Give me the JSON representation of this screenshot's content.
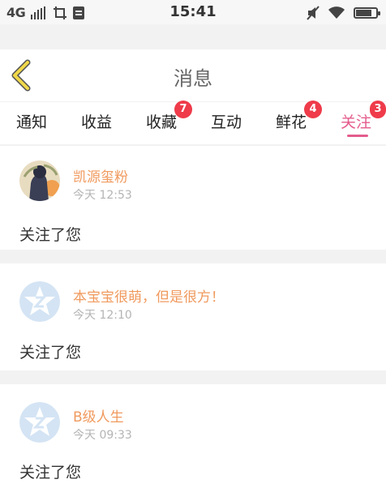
{
  "status_bar": {
    "network": "4G",
    "time": "15:41"
  },
  "header": {
    "title": "消息"
  },
  "tabs": [
    {
      "label": "通知",
      "badge": ""
    },
    {
      "label": "收益",
      "badge": ""
    },
    {
      "label": "收藏",
      "badge": "7"
    },
    {
      "label": "互动",
      "badge": ""
    },
    {
      "label": "鲜花",
      "badge": "4"
    },
    {
      "label": "关注",
      "badge": "3",
      "active": true
    }
  ],
  "messages": [
    {
      "name": "凯源玺粉",
      "time": "今天 12:53",
      "text": "关注了您",
      "avatar": "photo"
    },
    {
      "name": "本宝宝很萌，但是很方！",
      "time": "今天 12:10",
      "text": "关注了您",
      "avatar": "default"
    },
    {
      "name": "B级人生",
      "time": "今天 09:33",
      "text": "关注了您",
      "avatar": "default"
    }
  ],
  "colors": {
    "accent_pink": "#e45c8c",
    "badge_red": "#ef3b4a",
    "username_orange": "#f09a5e",
    "time_gray": "#b4b4b4",
    "back_arrow_yellow": "#f0d84a",
    "default_avatar_blue": "#d4e4f4"
  },
  "icons": {
    "back": "chevron-left-icon",
    "signal": "signal-bars-icon",
    "screenshot": "crop-icon",
    "sim": "sim-icon",
    "mute": "mute-icon",
    "wifi": "wifi-icon",
    "battery": "battery-icon",
    "default_avatar": "star-avatar-icon"
  },
  "battery_level": 0.8
}
